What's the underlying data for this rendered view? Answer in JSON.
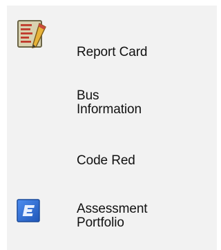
{
  "menu": {
    "items": [
      {
        "label": "Report Card",
        "icon": "report-card-icon"
      },
      {
        "label": "Bus\nInformation",
        "icon": null
      },
      {
        "label": "Code Red",
        "icon": null
      },
      {
        "label": "Assessment\nPortfolio",
        "icon": "assessment-portfolio-icon"
      }
    ]
  },
  "colors": {
    "panel_bg": "#f2f2f2",
    "text": "#111111",
    "report_card_accent": "#c0392b",
    "assessment_blue": "#2f6fd6"
  }
}
